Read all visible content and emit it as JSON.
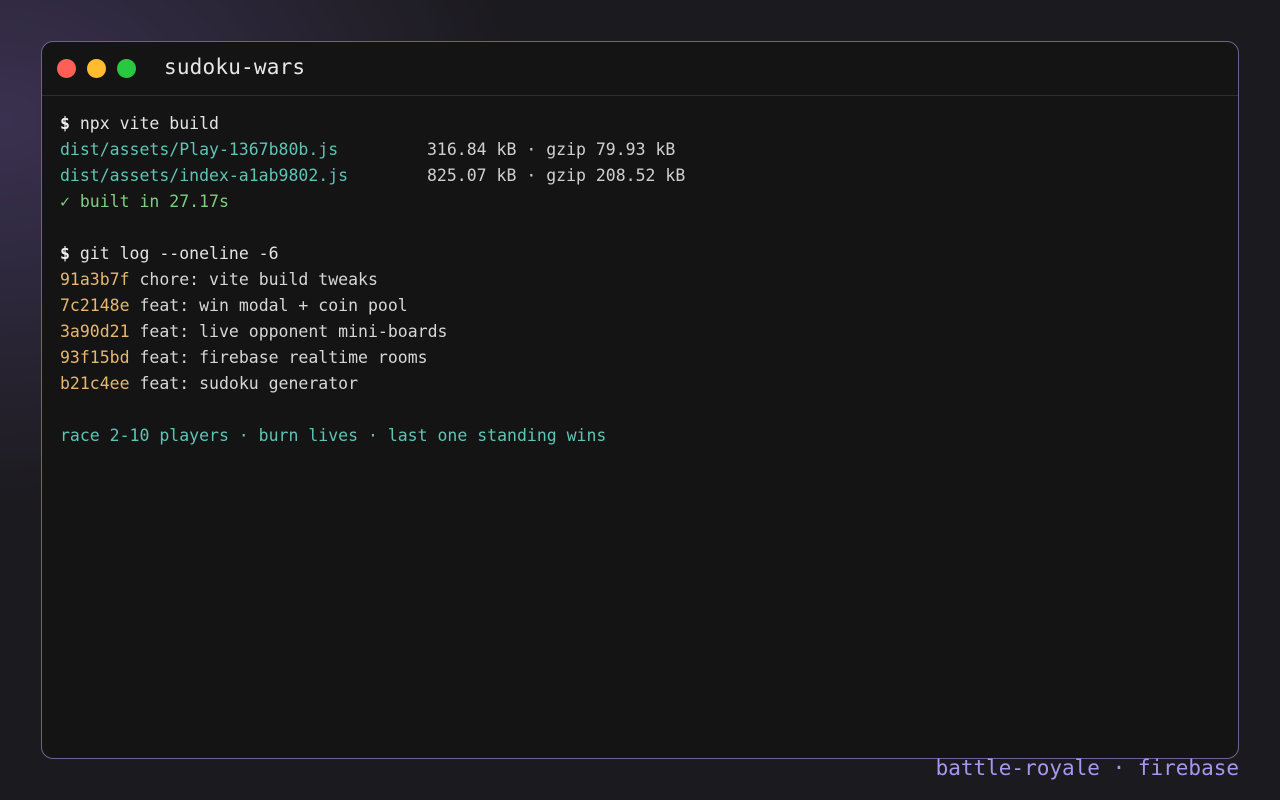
{
  "window": {
    "title": "sudoku-wars",
    "controls": {
      "close_color": "#ff5f57",
      "minimize_color": "#febc2e",
      "maximize_color": "#28c840"
    }
  },
  "terminal": {
    "prompt_symbol": "$",
    "build": {
      "command": "npx vite build",
      "assets": [
        {
          "path": "dist/assets/Play-1367b80b.js",
          "size": "316.84 kB · gzip 79.93 kB"
        },
        {
          "path": "dist/assets/index-a1ab9802.js",
          "size": "825.07 kB · gzip 208.52 kB"
        }
      ],
      "status": "✓ built in 27.17s"
    },
    "git": {
      "command": "git log --oneline -6",
      "commits": [
        {
          "hash": "91a3b7f",
          "message": "chore: vite build tweaks"
        },
        {
          "hash": "7c2148e",
          "message": "feat: win modal + coin pool"
        },
        {
          "hash": "3a90d21",
          "message": "feat: live opponent mini-boards"
        },
        {
          "hash": "93f15bd",
          "message": "feat: firebase realtime rooms"
        },
        {
          "hash": "b21c4ee",
          "message": "feat: sudoku generator"
        }
      ]
    },
    "tagline": "race 2-10 players · burn lives · last one standing wins"
  },
  "footer": {
    "text": "battle-royale · firebase"
  },
  "colors": {
    "accent": "#a895ef",
    "path": "#5ec4b6",
    "success": "#7fcf80",
    "hash": "#e6b86e"
  }
}
